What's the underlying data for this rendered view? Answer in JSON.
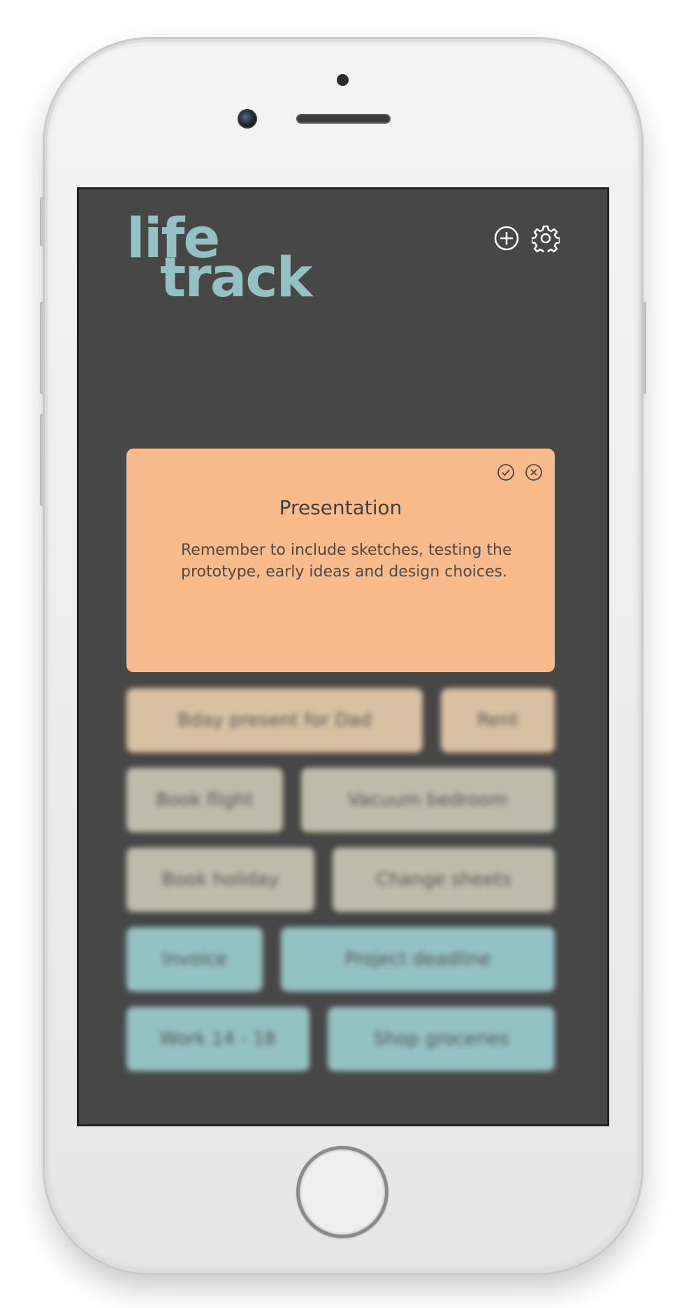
{
  "app": {
    "logo_line1": "life",
    "logo_line2": "track"
  },
  "header": {
    "add_icon": "plus-circle-icon",
    "settings_icon": "gear-icon"
  },
  "note": {
    "title": "Presentation",
    "body": "Remember to include sketches, testing the prototype, early ideas and design choices.",
    "confirm_icon": "check-circle-icon",
    "close_icon": "close-circle-icon",
    "color": "#f9bb8c"
  },
  "tasks": {
    "rows": [
      [
        {
          "label": "Bday present for Dad",
          "color": "peach"
        },
        {
          "label": "Rent",
          "color": "peach"
        }
      ],
      [
        {
          "label": "Book flight",
          "color": "sage"
        },
        {
          "label": "Vacuum bedroom",
          "color": "sage"
        }
      ],
      [
        {
          "label": "Book holiday",
          "color": "sage"
        },
        {
          "label": "Change sheets",
          "color": "sage"
        }
      ],
      [
        {
          "label": "Invoice",
          "color": "teal"
        },
        {
          "label": "Project deadline",
          "color": "teal"
        }
      ],
      [
        {
          "label": "Work 14 - 18",
          "color": "teal"
        },
        {
          "label": "Shop groceries",
          "color": "teal"
        }
      ]
    ]
  },
  "colors": {
    "screen_bg": "#474747",
    "brand": "#94c1c4",
    "peach": "#d9c0a2",
    "sage": "#bdbcab",
    "teal": "#94c1c4"
  }
}
